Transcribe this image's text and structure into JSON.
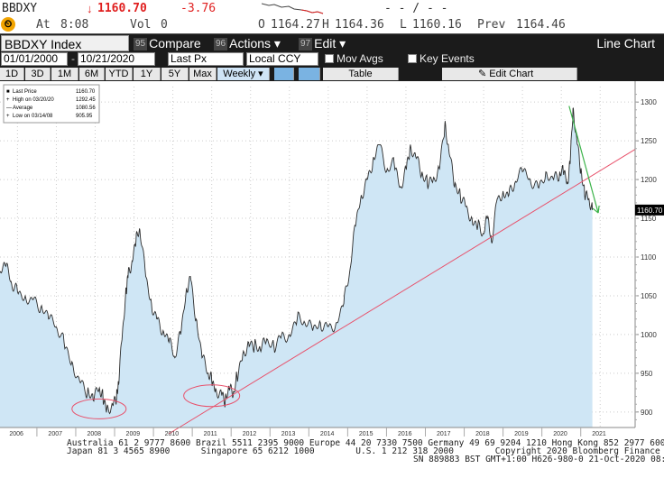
{
  "ticker": {
    "symbol": "BBDXY",
    "arrow": "↓",
    "last": "1160.70",
    "change": "-3.76",
    "dashes": "- - / - -",
    "at_label": "At",
    "time": "8:08",
    "vol_label": "Vol",
    "vol": "0",
    "open_label": "O",
    "open": "1164.27",
    "high_label": "H",
    "high": "1164.36",
    "low_label": "L",
    "low": "1160.16",
    "prev_label": "Prev",
    "prev": "1164.46"
  },
  "menubar": {
    "security": "BBDXY Index",
    "compare_num": "95",
    "compare": "Compare",
    "actions_num": "96",
    "actions": "Actions ▾",
    "edit_num": "97",
    "edit": "Edit ▾",
    "view": "Line Chart"
  },
  "controls": {
    "start_date": "01/01/2000",
    "end_date": "10/21/2020",
    "field": "Last Px",
    "currency": "Local CCY",
    "mov_avgs": "Mov Avgs",
    "key_events": "Key Events"
  },
  "periods": [
    "1D",
    "3D",
    "1M",
    "6M",
    "YTD",
    "1Y",
    "5Y",
    "Max"
  ],
  "frequency": "Weekly ▾",
  "table_btn": "Table",
  "edit_chart": "Edit Chart",
  "colors": {
    "area": "#cfe6f5",
    "line": "#2b2b2b",
    "trend": "#e8506a",
    "arrow": "#3cb34a",
    "circle": "#e8506a",
    "accent": "#ff0000"
  },
  "chart_data": {
    "type": "area",
    "legend": {
      "last_price_label": "Last Price",
      "last_price": "1160.70",
      "high_label": "High on 03/20/20",
      "high": "1292.45",
      "average_label": "Average",
      "average": "1080.56",
      "low_label": "Low on 03/14/08",
      "low": "905.95"
    },
    "last_tag": "1160.70",
    "x_ticks": [
      "2006",
      "2007",
      "2008",
      "2009",
      "2010",
      "2011",
      "2012",
      "2013",
      "2014",
      "2015",
      "2016",
      "2017",
      "2018",
      "2019",
      "2020",
      "2021"
    ],
    "y_ticks": [
      "1300",
      "1250",
      "1200",
      "1150",
      "1100",
      "1050",
      "1000",
      "950",
      "900"
    ],
    "ylim": [
      880,
      1320
    ],
    "x": [
      2005.55,
      2005.7,
      2005.85,
      2006.0,
      2006.2,
      2006.4,
      2006.6,
      2006.8,
      2007.0,
      2007.2,
      2007.4,
      2007.6,
      2007.8,
      2007.95,
      2008.1,
      2008.2,
      2008.3,
      2008.45,
      2008.55,
      2008.6,
      2008.7,
      2008.8,
      2008.85,
      2008.95,
      2009.05,
      2009.15,
      2009.3,
      2009.45,
      2009.6,
      2009.75,
      2009.9,
      2010.05,
      2010.2,
      2010.35,
      2010.45,
      2010.6,
      2010.75,
      2010.9,
      2011.0,
      2011.1,
      2011.25,
      2011.35,
      2011.45,
      2011.55,
      2011.65,
      2011.8,
      2011.95,
      2012.1,
      2012.25,
      2012.4,
      2012.6,
      2012.8,
      2013.0,
      2013.2,
      2013.4,
      2013.6,
      2013.8,
      2014.0,
      2014.2,
      2014.4,
      2014.55,
      2014.7,
      2014.85,
      2015.0,
      2015.15,
      2015.3,
      2015.5,
      2015.7,
      2015.85,
      2016.0,
      2016.1,
      2016.25,
      2016.4,
      2016.55,
      2016.7,
      2016.85,
      2017.0,
      2017.1,
      2017.25,
      2017.4,
      2017.55,
      2017.7,
      2017.85,
      2018.0,
      2018.1,
      2018.2,
      2018.35,
      2018.5,
      2018.65,
      2018.8,
      2019.0,
      2019.2,
      2019.4,
      2019.6,
      2019.8,
      2019.95,
      2020.05,
      2020.15,
      2020.22,
      2020.3,
      2020.4,
      2020.5,
      2020.6,
      2020.7,
      2020.8
    ],
    "values": [
      1080,
      1088,
      1065,
      1055,
      1050,
      1045,
      1035,
      1020,
      1010,
      990,
      965,
      940,
      925,
      915,
      930,
      920,
      905,
      910,
      918,
      935,
      1000,
      1060,
      1080,
      1095,
      1120,
      1135,
      1075,
      1040,
      1020,
      1005,
      990,
      970,
      1000,
      1060,
      1075,
      1020,
      970,
      950,
      940,
      930,
      925,
      915,
      930,
      920,
      945,
      975,
      990,
      985,
      980,
      990,
      985,
      1000,
      1000,
      1020,
      1015,
      1005,
      1015,
      1010,
      1015,
      1040,
      1080,
      1140,
      1180,
      1200,
      1225,
      1245,
      1210,
      1220,
      1190,
      1215,
      1240,
      1230,
      1205,
      1195,
      1200,
      1215,
      1270,
      1240,
      1190,
      1180,
      1165,
      1150,
      1140,
      1130,
      1150,
      1120,
      1175,
      1185,
      1180,
      1195,
      1210,
      1200,
      1190,
      1210,
      1200,
      1205,
      1210,
      1195,
      1220,
      1292,
      1250,
      1210,
      1180,
      1175,
      1164,
      1160.7
    ]
  }
}
